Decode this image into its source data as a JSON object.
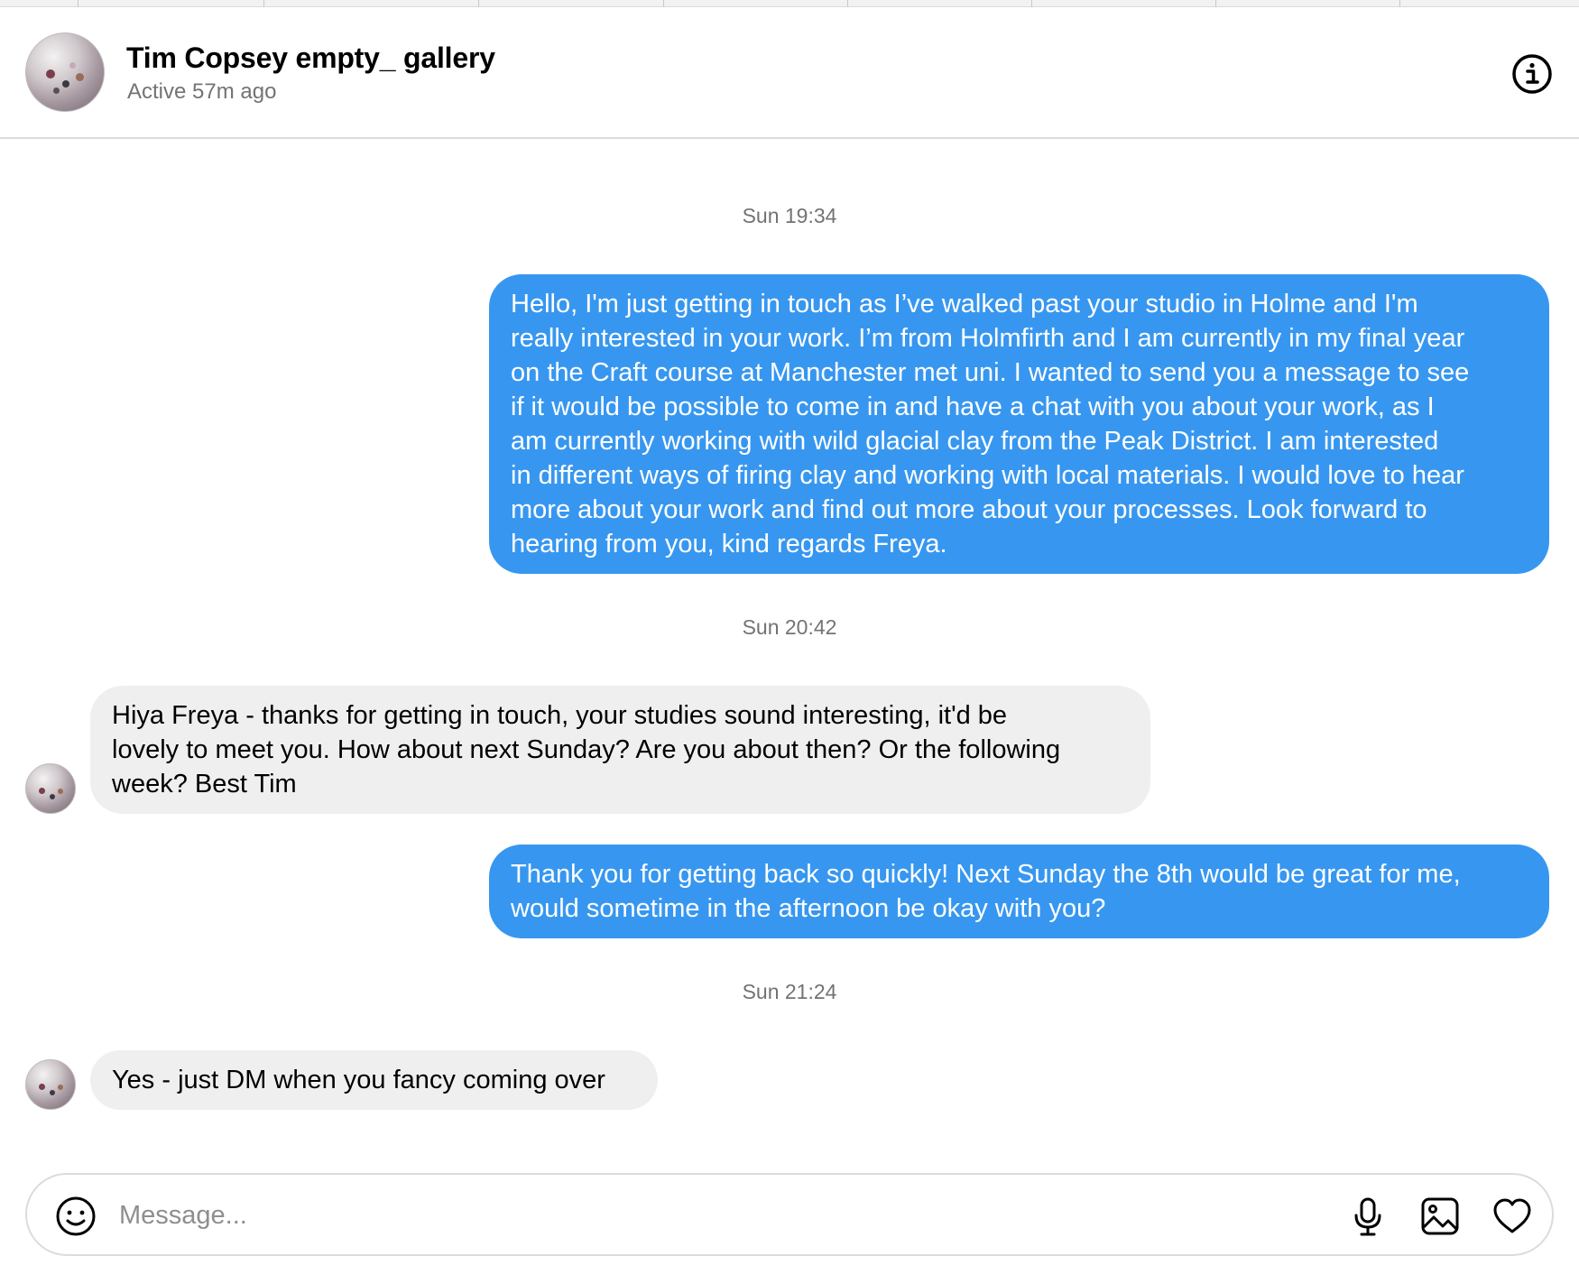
{
  "header": {
    "title": "Tim Copsey empty_ gallery",
    "status": "Active 57m ago",
    "info_icon": "info-icon"
  },
  "thread": {
    "groups": [
      {
        "timestamp": "Sun 19:34"
      },
      {
        "timestamp": "Sun 20:42"
      },
      {
        "timestamp": "Sun 21:24"
      }
    ],
    "messages": [
      {
        "direction": "outgoing",
        "lines": [
          "Hello, I'm just getting in touch as I’ve walked past your studio in Holme and I'm",
          "really interested in your work. I’m from Holmfirth and I am currently in my final year",
          "on the Craft course at Manchester met uni. I wanted to send you a message to see",
          "if it would be possible to come in and have a chat with you about your work, as I",
          "am currently working with wild glacial clay from the Peak District. I am interested",
          "in different ways of firing clay and working with local materials. I would love to hear",
          "more about your work and find out more about your processes. Look forward to",
          "hearing from you, kind regards Freya."
        ]
      },
      {
        "direction": "incoming",
        "lines": [
          "Hiya Freya - thanks for getting in touch, your studies sound interesting, it'd be",
          "lovely to meet you. How about next Sunday? Are you about then? Or the following",
          "week? Best Tim"
        ]
      },
      {
        "direction": "outgoing",
        "lines": [
          "Thank you for getting back so quickly! Next Sunday the 8th would be great for me,",
          "would sometime in the afternoon be okay with you?"
        ]
      },
      {
        "direction": "incoming",
        "lines": [
          "Yes - just DM when you fancy coming over"
        ]
      }
    ]
  },
  "composer": {
    "placeholder": "Message...",
    "icons": [
      "emoji-icon",
      "microphone-icon",
      "image-icon",
      "heart-icon"
    ]
  },
  "colors": {
    "outgoing_bubble": "#3797f0",
    "incoming_bubble": "#efefef",
    "muted_text": "#737373",
    "border": "#dbdbdb"
  }
}
